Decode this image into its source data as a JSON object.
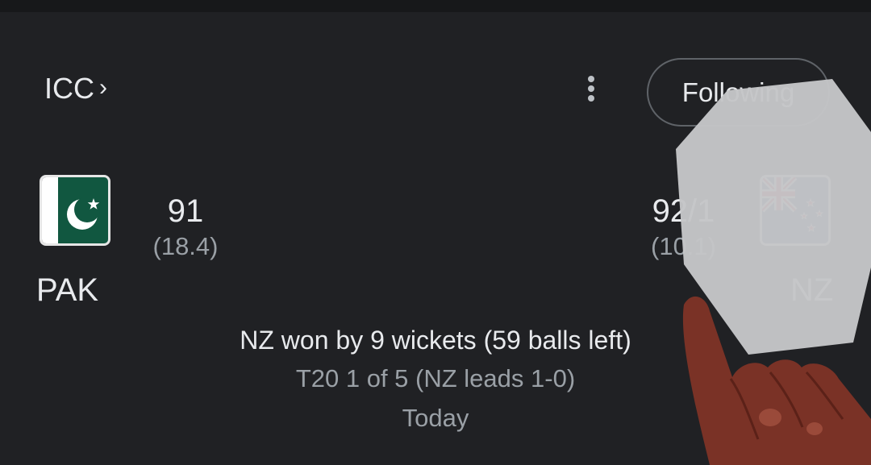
{
  "header": {
    "league_label": "ICC",
    "breadcrumb_chevron": "›",
    "more_icon": "more-vert-icon",
    "follow_label": "Following"
  },
  "match": {
    "home": {
      "name": "PAK",
      "score": "91",
      "overs": "(18.4)",
      "flag": "pakistan-flag"
    },
    "away": {
      "name": "NZ",
      "score": "92/1",
      "overs": "(10.1)",
      "flag": "new-zealand-flag"
    },
    "result": "NZ won by 9 wickets (59 balls left)",
    "series": "T20 1 of 5 (NZ leads 1-0)",
    "date": "Today"
  },
  "colors": {
    "background": "#202124",
    "text_primary": "#e8eaed",
    "text_secondary": "#9aa0a6",
    "outline": "#5f6368"
  }
}
